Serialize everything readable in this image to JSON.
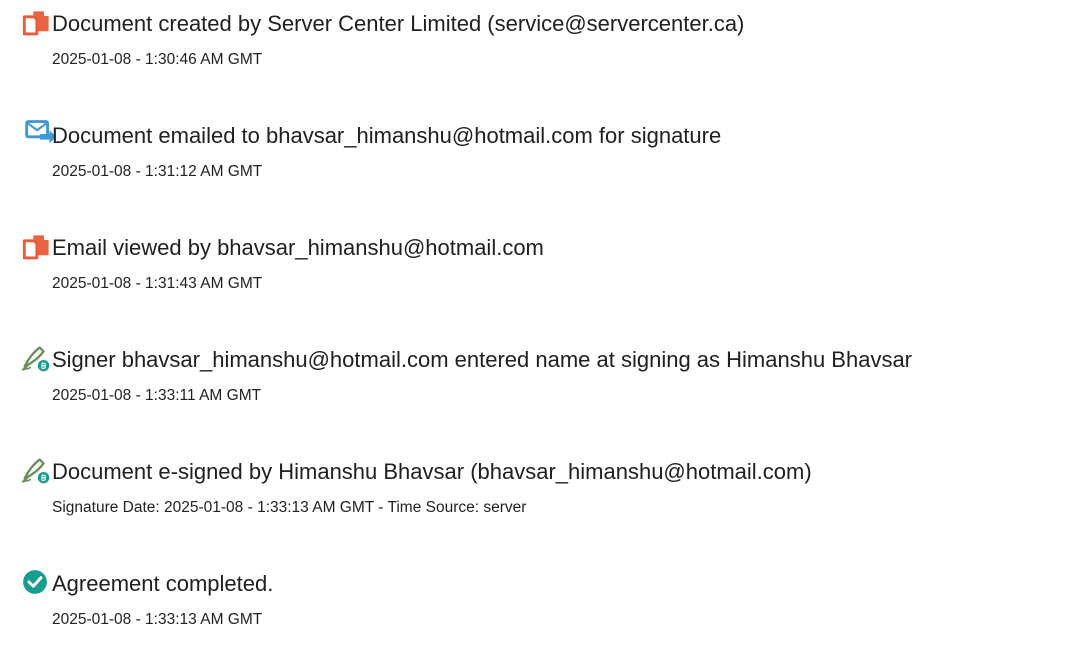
{
  "events": [
    {
      "icon": "document-created-icon",
      "title": "Document created by Server Center Limited (service@servercenter.ca)",
      "meta": "2025-01-08 - 1:30:46 AM GMT"
    },
    {
      "icon": "email-sent-icon",
      "title": "Document emailed to bhavsar_himanshu@hotmail.com for signature",
      "meta": "2025-01-08 - 1:31:12 AM GMT"
    },
    {
      "icon": "email-viewed-icon",
      "title": "Email viewed by bhavsar_himanshu@hotmail.com",
      "meta": "2025-01-08 - 1:31:43 AM GMT"
    },
    {
      "icon": "signature-pen-icon",
      "title": "Signer bhavsar_himanshu@hotmail.com entered name at signing as Himanshu Bhavsar",
      "meta": "2025-01-08 - 1:33:11 AM GMT"
    },
    {
      "icon": "signature-pen-icon",
      "title": "Document e-signed by Himanshu Bhavsar (bhavsar_himanshu@hotmail.com)",
      "meta": "Signature Date: 2025-01-08 - 1:33:13 AM GMT - Time Source: server"
    },
    {
      "icon": "checkmark-circle-icon",
      "title": "Agreement completed.",
      "meta": "2025-01-08 - 1:33:13 AM GMT"
    }
  ],
  "colors": {
    "document_icon": "#EB5B35",
    "email_icon": "#3E9AD7",
    "signature_icon": "#6A8E5A",
    "completed_icon": "#159E8E",
    "text": "#202020"
  }
}
